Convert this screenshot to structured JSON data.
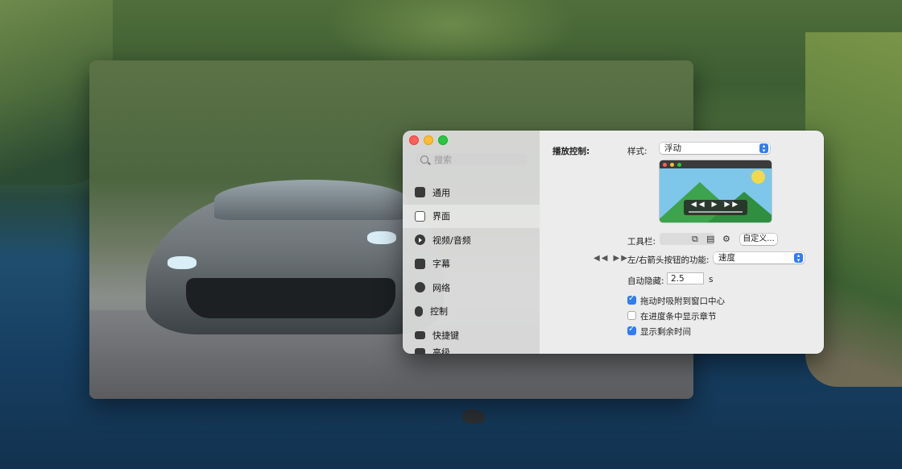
{
  "sidebar": {
    "search_placeholder": "搜索",
    "items": [
      {
        "label": "通用",
        "icon": "general-icon"
      },
      {
        "label": "界面",
        "icon": "interface-icon",
        "active": true
      },
      {
        "label": "视频/音频",
        "icon": "play-icon"
      },
      {
        "label": "字幕",
        "icon": "subtitle-icon"
      },
      {
        "label": "网络",
        "icon": "globe-icon"
      },
      {
        "label": "控制",
        "icon": "mouse-icon"
      },
      {
        "label": "快捷键",
        "icon": "keyboard-icon"
      },
      {
        "label": "高级",
        "icon": "advanced-icon"
      }
    ]
  },
  "content": {
    "section_label": "播放控制:",
    "style_label": "样式:",
    "style_value": "浮动",
    "toolbar_label": "工具栏:",
    "customize_button": "自定义...",
    "arrow_function_label": "左/右箭头按钮的功能:",
    "arrow_function_value": "速度",
    "auto_hide_label": "自动隐藏:",
    "auto_hide_value": "2.5",
    "auto_hide_unit": "s",
    "checkboxes": [
      {
        "label": "拖动时吸附到窗口中心",
        "checked": true
      },
      {
        "label": "在进度条中显示章节",
        "checked": false
      },
      {
        "label": "显示剩余时间",
        "checked": true
      }
    ]
  },
  "colors": {
    "accent": "#2f7cf6",
    "close": "#ff5f57",
    "minimize": "#febc2e",
    "maximize": "#28c840"
  }
}
